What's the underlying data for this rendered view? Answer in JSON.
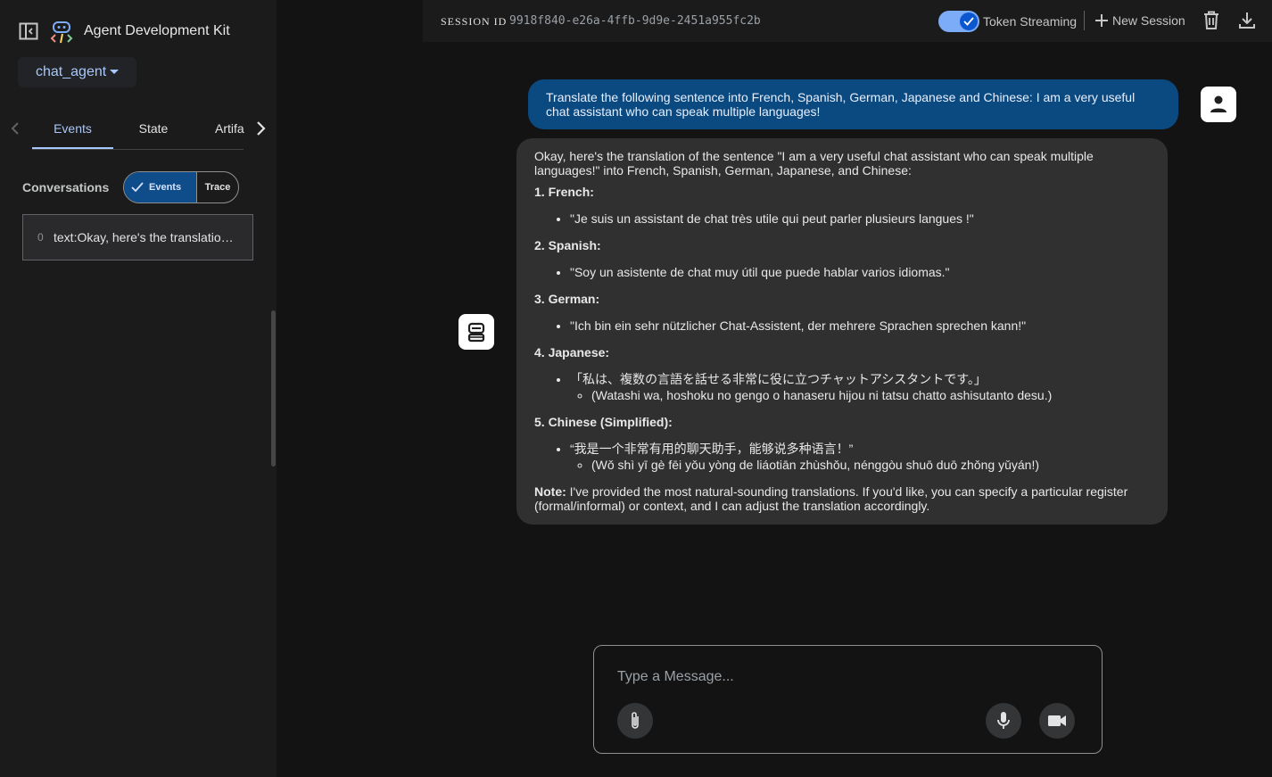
{
  "sidebar": {
    "app_title": "Agent Development Kit",
    "agent_name": "chat_agent",
    "tabs": [
      {
        "label": "Events",
        "active": true
      },
      {
        "label": "State",
        "active": false
      },
      {
        "label": "Artifa",
        "active": false
      }
    ],
    "conversations_label": "Conversations",
    "view_toggle": {
      "events_label": "Events",
      "trace_label": "Trace",
      "selected": "Events"
    },
    "events": [
      {
        "index": "0",
        "text": "text:Okay, here's the translation of the sentence \"I am a very useful chat assistant who can speak multiple languages!\""
      }
    ]
  },
  "topbar": {
    "session_label": "SESSION ID",
    "session_id": "9918f840-e26a-4ffb-9d9e-2451a955fc2b",
    "token_streaming_label": "Token Streaming",
    "token_streaming_on": true,
    "new_session_label": "New Session"
  },
  "chat": {
    "user_message": "Translate the following sentence into French, Spanish, German, Japanese and Chinese: I am a very useful chat assistant who can speak multiple languages!",
    "bot": {
      "intro": "Okay, here's the translation of the sentence \"I am a very useful chat assistant who can speak multiple languages!\" into French, Spanish, German, Japanese, and Chinese:",
      "sections": [
        {
          "heading": "1. French:",
          "text": "\"Je suis un assistant de chat très utile qui peut parler plusieurs langues !\""
        },
        {
          "heading": "2. Spanish:",
          "text": "\"Soy un asistente de chat muy útil que puede hablar varios idiomas.\""
        },
        {
          "heading": "3. German:",
          "text": "\"Ich bin ein sehr nützlicher Chat-Assistent, der mehrere Sprachen sprechen kann!\""
        },
        {
          "heading": "4. Japanese:",
          "text": "「私は、複数の言語を話せる非常に役に立つチャットアシスタントです。」",
          "sub": "(Watashi wa, hoshoku no gengo o hanaseru hijou ni tatsu chatto ashisutanto desu.)"
        },
        {
          "heading": "5. Chinese (Simplified):",
          "text": "“我是一个非常有用的聊天助手，能够说多种语言！”",
          "sub": "(Wǒ shì yī gè fēi yǒu yòng de liáotiān zhùshǒu, nénggòu shuō duō zhǒng yǔyán!)"
        }
      ],
      "note_label": "Note:",
      "note_text": " I've provided the most natural-sounding translations. If you'd like, you can specify a particular register (formal/informal) or context, and I can adjust the translation accordingly."
    }
  },
  "composer": {
    "placeholder": "Type a Message..."
  },
  "colors": {
    "accent": "#a8c7fa",
    "user_bubble": "#0b4a80",
    "bot_bubble": "#303030",
    "background": "#131314",
    "sidebar": "#1b1b1b"
  }
}
